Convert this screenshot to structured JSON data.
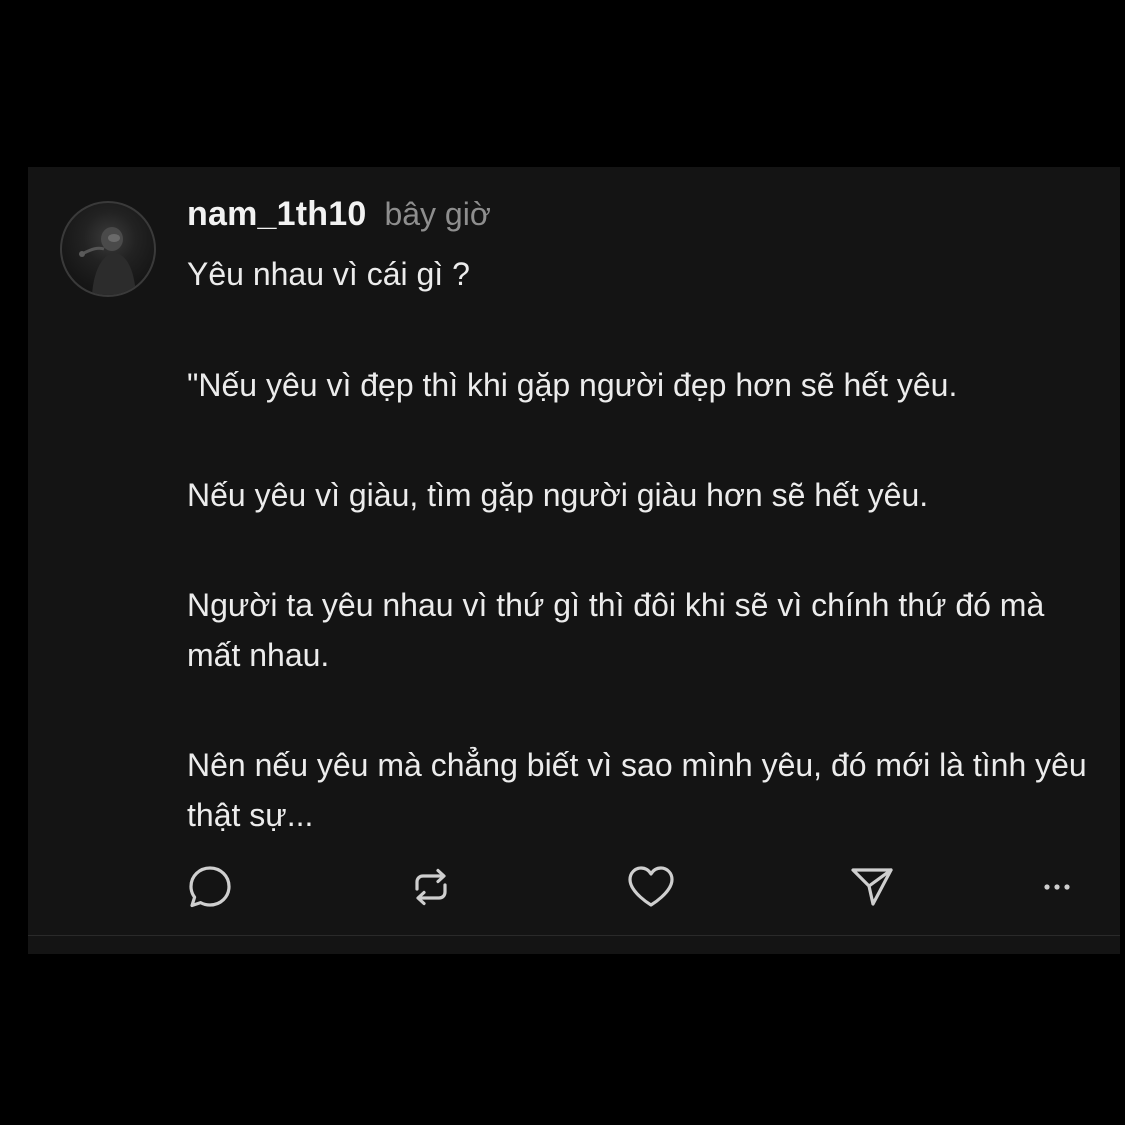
{
  "post": {
    "username": "nam_1th10",
    "timestamp": "bây giờ",
    "paragraphs": [
      "Yêu nhau vì cái gì ?",
      "\"Nếu yêu vì đẹp thì khi gặp người đẹp hơn sẽ hết yêu.",
      "Nếu yêu vì giàu, tìm gặp người giàu hơn sẽ hết yêu.",
      "Người ta yêu nhau vì thứ gì thì đôi khi sẽ vì chính thứ đó mà mất nhau.",
      "Nên nếu yêu mà chẳng biết vì sao mình yêu, đó mới là tình yêu thật sự..."
    ]
  },
  "actions": [
    {
      "icon": "comment-icon"
    },
    {
      "icon": "repost-icon"
    },
    {
      "icon": "heart-icon"
    },
    {
      "icon": "share-icon"
    },
    {
      "icon": "more-icon"
    }
  ],
  "colors": {
    "background": "#000000",
    "card": "#141414",
    "text": "#ececec",
    "muted": "#8e8e8e",
    "icon": "#cfcfcf"
  }
}
